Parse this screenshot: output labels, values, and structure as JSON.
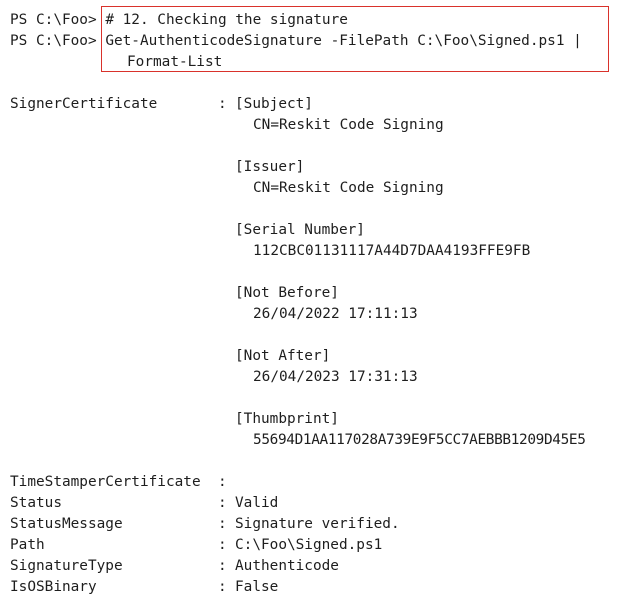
{
  "prompts": {
    "line1": "PS C:\\Foo>",
    "line2": "PS C:\\Foo>"
  },
  "command": {
    "comment": "# 12. Checking the signature",
    "line1": "Get-AuthenticodeSignature -FilePath C:\\Foo\\Signed.ps1 |",
    "line2": "Format-List"
  },
  "signer": {
    "key": "SignerCertificate",
    "colon": ":",
    "subject_header": "[Subject]",
    "subject_value": "CN=Reskit Code Signing",
    "issuer_header": "[Issuer]",
    "issuer_value": "CN=Reskit Code Signing",
    "serial_header": "[Serial Number]",
    "serial_value": "112CBC01131117A44D7DAA4193FFE9FB",
    "notbefore_header": "[Not Before]",
    "notbefore_value": "26/04/2022 17:11:13",
    "notafter_header": "[Not After]",
    "notafter_value": "26/04/2023 17:31:13",
    "thumb_header": "[Thumbprint]",
    "thumb_value": "55694D1AA117028A739E9F5CC7AEBBB1209D45E5"
  },
  "properties": [
    {
      "key": "TimeStamperCertificate",
      "colon": ":",
      "value": ""
    },
    {
      "key": "Status",
      "colon": ":",
      "value": "Valid"
    },
    {
      "key": "StatusMessage",
      "colon": ":",
      "value": "Signature verified."
    },
    {
      "key": "Path",
      "colon": ":",
      "value": "C:\\Foo\\Signed.ps1"
    },
    {
      "key": "SignatureType",
      "colon": ":",
      "value": "Authenticode"
    },
    {
      "key": "IsOSBinary",
      "colon": ":",
      "value": "False"
    }
  ],
  "colors": {
    "highlight_border": "#d9322b",
    "text": "#1e1e1e",
    "background": "#ffffff"
  }
}
